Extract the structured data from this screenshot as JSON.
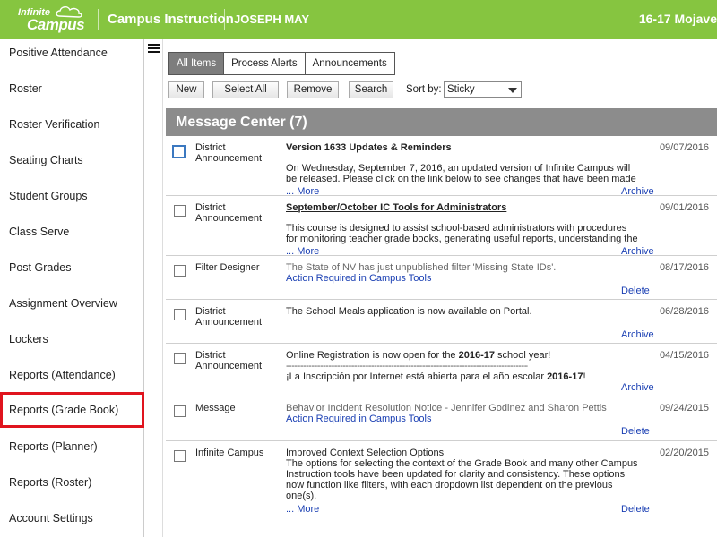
{
  "header": {
    "logo_top": "Infinite",
    "logo_bottom": "Campus",
    "app_title": "Campus Instruction",
    "user_name": "JOSEPH MAY",
    "school_context": "16-17 Mojave"
  },
  "sidebar": {
    "items": [
      {
        "label": "Positive Attendance"
      },
      {
        "label": "Roster"
      },
      {
        "label": "Roster Verification"
      },
      {
        "label": "Seating Charts"
      },
      {
        "label": "Student Groups"
      },
      {
        "label": "Class Serve"
      },
      {
        "label": "Post Grades"
      },
      {
        "label": "Assignment Overview"
      },
      {
        "label": "Lockers"
      },
      {
        "label": "Reports (Attendance)"
      },
      {
        "label": "Reports (Grade Book)",
        "highlighted": true
      },
      {
        "label": "Reports (Planner)"
      },
      {
        "label": "Reports (Roster)"
      },
      {
        "label": "Account Settings"
      }
    ]
  },
  "tabs": [
    {
      "label": "All Items",
      "active": true
    },
    {
      "label": "Process Alerts"
    },
    {
      "label": "Announcements"
    }
  ],
  "toolbar": {
    "new_label": "New",
    "select_all_label": "Select All",
    "remove_label": "Remove",
    "search_label": "Search",
    "sort_label": "Sort by:",
    "sort_value": "Sticky"
  },
  "message_center": {
    "title": "Message Center (7)",
    "messages": [
      {
        "type": "District Announcement",
        "subject": "Version 1633 Updates & Reminders",
        "text": "On Wednesday, September 7, 2016, an updated version of Infinite Campus will be released. Please click on the link below to see changes that have been made in this",
        "more": "... More",
        "action": "Archive",
        "date": "09/07/2016"
      },
      {
        "type": "District Announcement",
        "subject": "September/October IC Tools for Administrators",
        "text": "This course is designed to assist school-based administrators with procedures for monitoring teacher grade books, generating useful reports, understanding the",
        "more": "... More",
        "action": "Archive",
        "date": "09/01/2016"
      },
      {
        "type": "Filter Designer",
        "text": "The State of NV has just unpublished filter 'Missing State IDs'.",
        "link": "Action Required in Campus Tools",
        "action": "Delete",
        "date": "08/17/2016"
      },
      {
        "type": "District Announcement",
        "text": "The School Meals application is now available on Portal.",
        "action": "Archive",
        "date": "06/28/2016"
      },
      {
        "type": "District Announcement",
        "text_a": "Online Registration is now open for the ",
        "text_b": "2016-17",
        "text_c": " school year!",
        "dashes": "----------------------------------------------------------------------------------------------",
        "text_d": "¡La Inscripción por Internet está abierta para el año escolar ",
        "text_e": "2016-17",
        "text_f": "!",
        "action": "Archive",
        "date": "04/15/2016"
      },
      {
        "type": "Message",
        "text": "Behavior Incident Resolution Notice - Jennifer Godinez and Sharon Pettis",
        "link": "Action Required in Campus Tools",
        "action": "Delete",
        "date": "09/24/2015"
      },
      {
        "type": "Infinite Campus",
        "subject": "Improved Context Selection Options",
        "text": "The options for selecting the context of the Grade Book and many other Campus Instruction tools have been updated for clarity and consistency. These options now function like filters, with each dropdown list dependent on the previous one(s).",
        "more": "... More",
        "action": "Delete",
        "date": "02/20/2015"
      }
    ]
  }
}
